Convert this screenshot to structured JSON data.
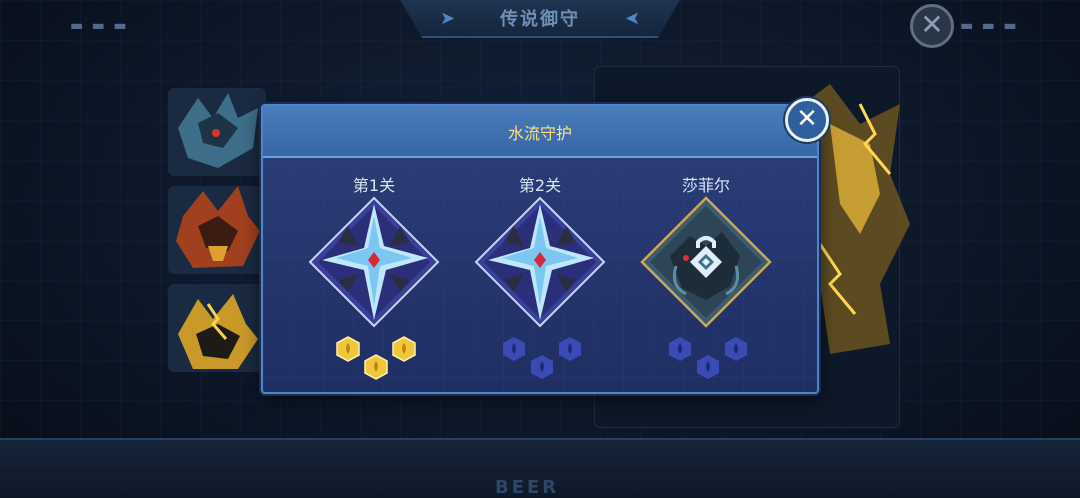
{
  "header": {
    "title": "传说御守"
  },
  "bottom": {
    "text": "BEER"
  },
  "modal": {
    "title": "水流守护",
    "stages": [
      {
        "label": "第1关",
        "state": "cleared",
        "icon": "crystal-star-icon",
        "rewards": [
          "gold-coin",
          "gold-coin",
          "gold-coin"
        ]
      },
      {
        "label": "第2关",
        "state": "available",
        "icon": "crystal-star-icon",
        "rewards": [
          "water-drop",
          "water-drop",
          "water-drop"
        ]
      },
      {
        "label": "莎菲尔",
        "state": "locked",
        "icon": "boss-lock-icon",
        "rewards": [
          "water-drop",
          "water-drop",
          "water-drop"
        ]
      }
    ]
  },
  "colors": {
    "modal_bg": "#25366d",
    "header_bg": "#3f72b2",
    "title_color": "#ffe27a",
    "gold": "#f0c73a",
    "water_token": "#3a4bb5"
  }
}
